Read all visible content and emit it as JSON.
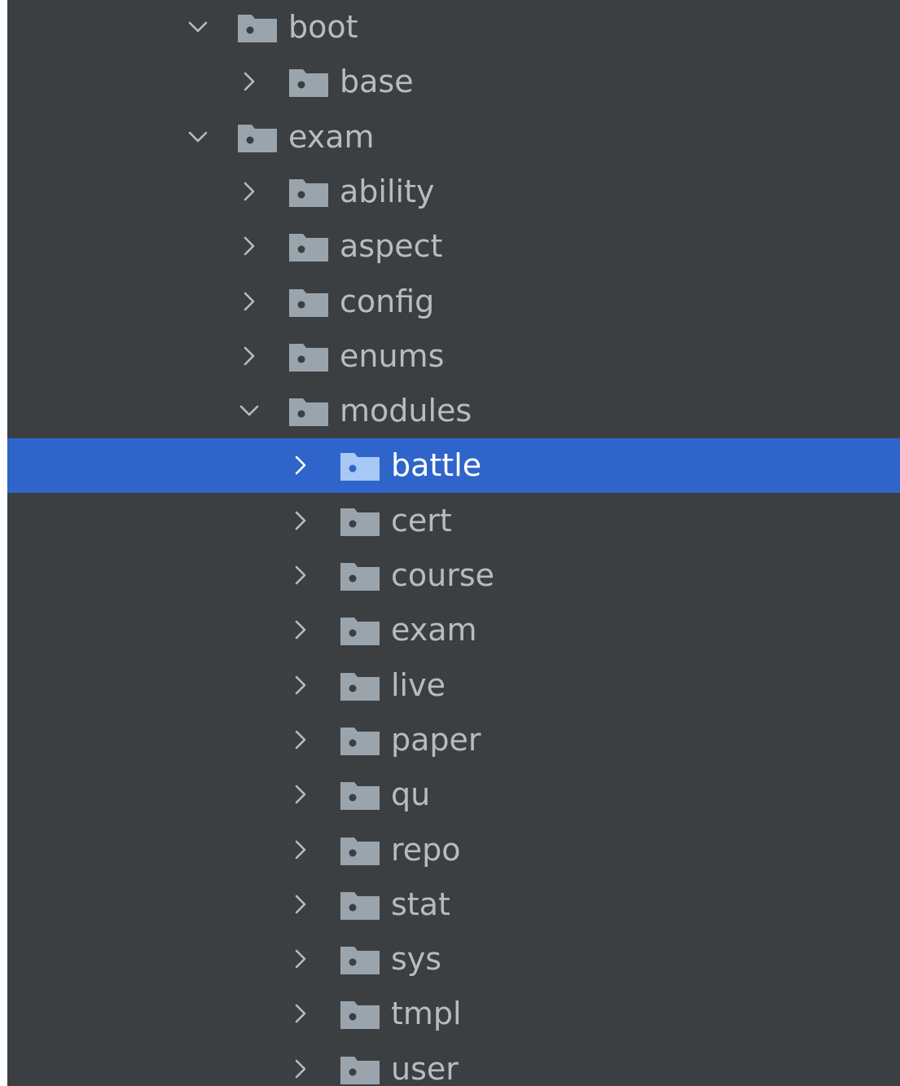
{
  "colors": {
    "panel_bg": "#3c3f41",
    "selection_bg": "#2f65ca",
    "text": "#b7bcc0",
    "selected_text": "#ffffff",
    "folder": "#9aa4ad",
    "folder_selected": "#a8c8f5"
  },
  "tree": {
    "items": [
      {
        "label": "boot",
        "depth": 0,
        "expanded": true,
        "selected": false
      },
      {
        "label": "base",
        "depth": 1,
        "expanded": false,
        "selected": false
      },
      {
        "label": "exam",
        "depth": 0,
        "expanded": true,
        "selected": false
      },
      {
        "label": "ability",
        "depth": 1,
        "expanded": false,
        "selected": false
      },
      {
        "label": "aspect",
        "depth": 1,
        "expanded": false,
        "selected": false
      },
      {
        "label": "config",
        "depth": 1,
        "expanded": false,
        "selected": false
      },
      {
        "label": "enums",
        "depth": 1,
        "expanded": false,
        "selected": false
      },
      {
        "label": "modules",
        "depth": 1,
        "expanded": true,
        "selected": false
      },
      {
        "label": "battle",
        "depth": 2,
        "expanded": false,
        "selected": true
      },
      {
        "label": "cert",
        "depth": 2,
        "expanded": false,
        "selected": false
      },
      {
        "label": "course",
        "depth": 2,
        "expanded": false,
        "selected": false
      },
      {
        "label": "exam",
        "depth": 2,
        "expanded": false,
        "selected": false
      },
      {
        "label": "live",
        "depth": 2,
        "expanded": false,
        "selected": false
      },
      {
        "label": "paper",
        "depth": 2,
        "expanded": false,
        "selected": false
      },
      {
        "label": "qu",
        "depth": 2,
        "expanded": false,
        "selected": false
      },
      {
        "label": "repo",
        "depth": 2,
        "expanded": false,
        "selected": false
      },
      {
        "label": "stat",
        "depth": 2,
        "expanded": false,
        "selected": false
      },
      {
        "label": "sys",
        "depth": 2,
        "expanded": false,
        "selected": false
      },
      {
        "label": "tmpl",
        "depth": 2,
        "expanded": false,
        "selected": false
      },
      {
        "label": "user",
        "depth": 2,
        "expanded": false,
        "selected": false
      }
    ]
  }
}
